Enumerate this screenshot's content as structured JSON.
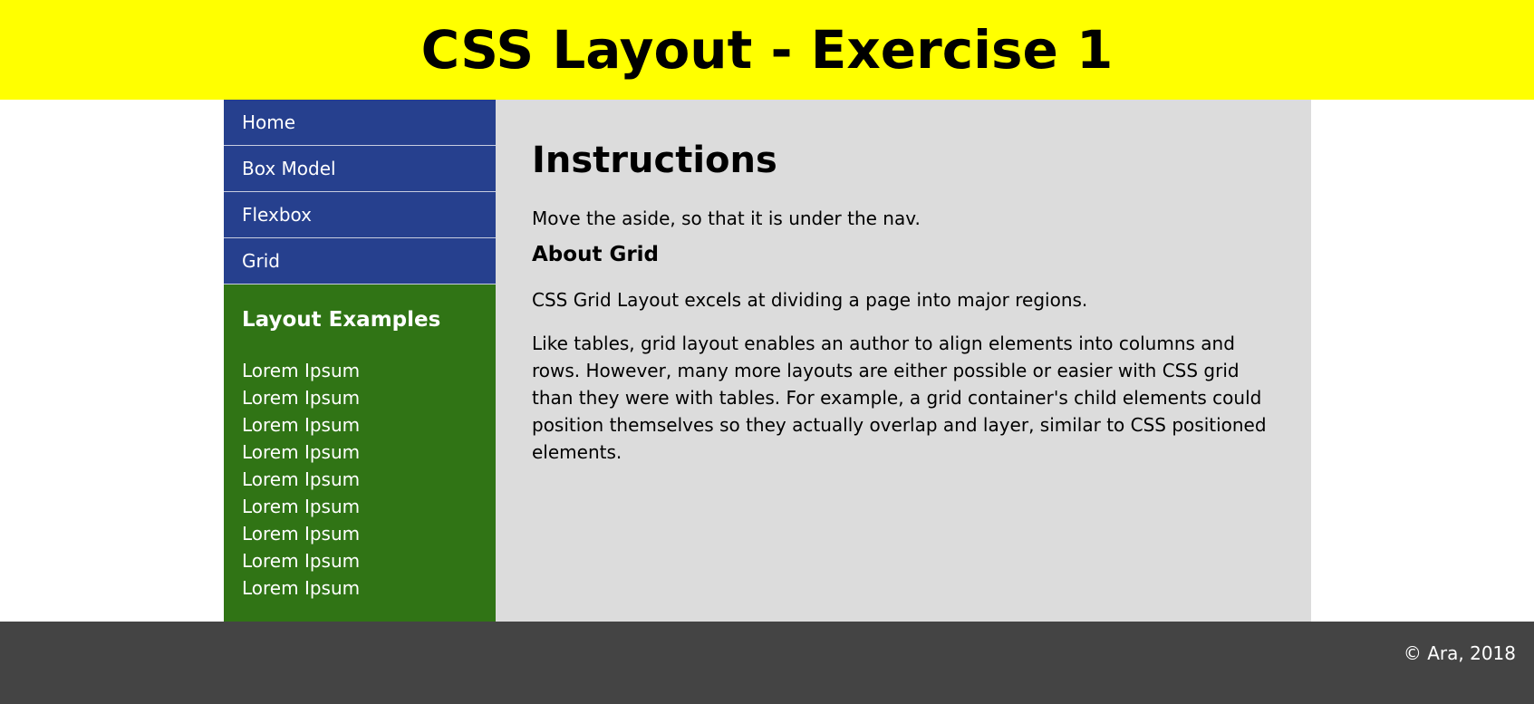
{
  "header": {
    "title": "CSS Layout - Exercise 1"
  },
  "nav": {
    "items": [
      {
        "label": "Home"
      },
      {
        "label": "Box Model"
      },
      {
        "label": "Flexbox"
      },
      {
        "label": "Grid"
      }
    ]
  },
  "aside": {
    "heading": "Layout Examples",
    "items": [
      "Lorem Ipsum",
      "Lorem Ipsum",
      "Lorem Ipsum",
      "Lorem Ipsum",
      "Lorem Ipsum",
      "Lorem Ipsum",
      "Lorem Ipsum",
      "Lorem Ipsum",
      "Lorem Ipsum"
    ]
  },
  "main": {
    "heading": "Instructions",
    "intro": "Move the aside, so that it is under the nav.",
    "subheading": "About Grid",
    "paragraph1": "CSS Grid Layout excels at dividing a page into major regions.",
    "paragraph2": "Like tables, grid layout enables an author to align elements into columns and rows. However, many more layouts are either possible or easier with CSS grid than they were with tables. For example, a grid container's child elements could position themselves so they actually overlap and layer, similar to CSS positioned elements."
  },
  "footer": {
    "copyright": "© Ara, 2018"
  },
  "colors": {
    "header_bg": "#ffff00",
    "nav_bg": "#26408e",
    "aside_bg": "#307415",
    "main_bg": "#dcdcdc",
    "footer_bg": "#444444"
  }
}
